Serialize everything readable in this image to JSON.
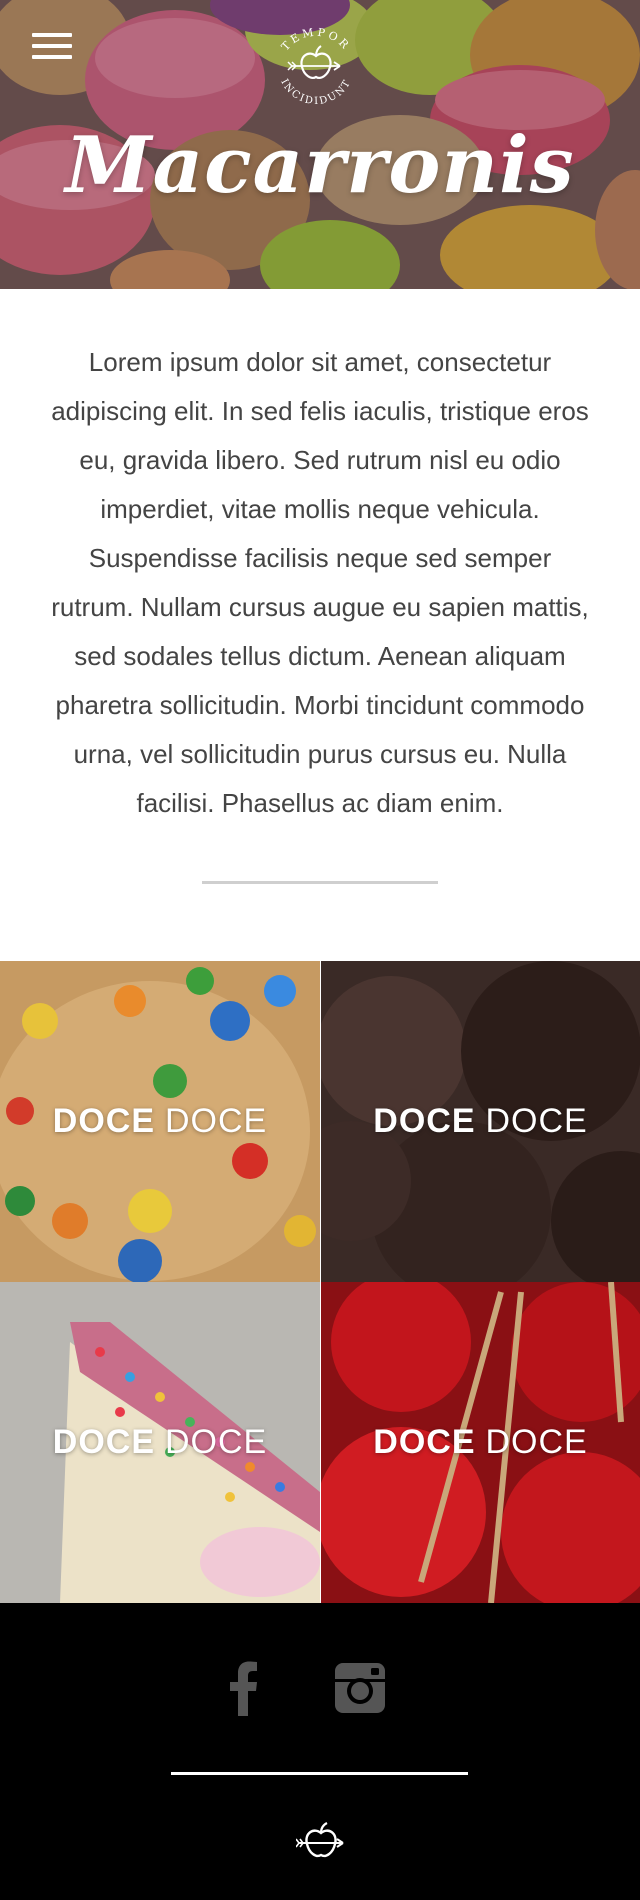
{
  "header": {
    "menu_icon": "hamburger-menu-icon",
    "logo_top_text": "TEMPOR",
    "logo_bottom_text": "INCIDIDUNT",
    "title": "Macarronis"
  },
  "intro": {
    "text": "Lorem ipsum dolor sit amet, consectetur adipiscing elit. In sed felis iaculis, tristique eros eu, gravida libero. Sed rutrum nisl eu odio imperdiet, vitae mollis neque vehicula. Suspendisse facilisis neque sed semper rutrum. Nullam cursus augue eu sapien mattis, sed sodales tellus dictum. Aenean aliquam pharetra sollicitudin. Morbi tincidunt commodo urna, vel sollicitudin purus cursus eu. Nulla facilisi. Phasellus ac diam enim."
  },
  "products": [
    {
      "bold": "DOCE",
      "light": "DOCE"
    },
    {
      "bold": "DOCE",
      "light": "DOCE"
    },
    {
      "bold": "DOCE",
      "light": "DOCE"
    },
    {
      "bold": "DOCE",
      "light": "DOCE"
    }
  ],
  "footer": {
    "social": [
      "facebook-icon",
      "instagram-icon"
    ],
    "logo_icon": "apple-arrow-logo-icon"
  },
  "colors": {
    "footer_bg": "#000000",
    "divider": "#cfcfcf",
    "text": "#444444"
  }
}
